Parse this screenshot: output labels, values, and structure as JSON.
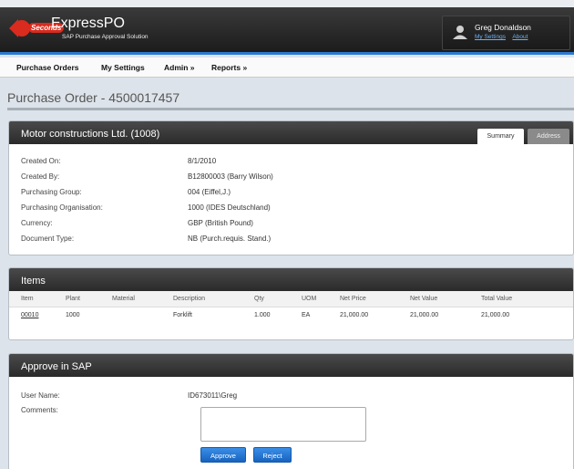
{
  "app": {
    "logo_word": "Seconds",
    "title": "ExpressPO",
    "subtitle": "SAP Purchase Approval Solution"
  },
  "user": {
    "name": "Greg Donaldson",
    "links": [
      "My Settings",
      "About"
    ]
  },
  "nav": [
    "Purchase Orders",
    "My Settings",
    "Admin »",
    "Reports »"
  ],
  "page_title": "Purchase Order - 4500017457",
  "header_panel": {
    "title": "Motor constructions Ltd. (1008)",
    "tabs": [
      "Summary",
      "Address"
    ],
    "active_tab": "Summary",
    "fields": [
      {
        "label": "Created On:",
        "value": "8/1/2010"
      },
      {
        "label": "Created By:",
        "value": "B12800003 (Barry Wilson)"
      },
      {
        "label": "Purchasing Group:",
        "value": "004 (Eiffel,J.)"
      },
      {
        "label": "Purchasing Organisation:",
        "value": "1000 (IDES Deutschland)"
      },
      {
        "label": "Currency:",
        "value": "GBP (British Pound)"
      },
      {
        "label": "Document Type:",
        "value": "NB (Purch.requis. Stand.)"
      }
    ]
  },
  "items_panel": {
    "title": "Items",
    "columns": [
      "Item",
      "Plant",
      "Material",
      "Description",
      "Qty",
      "UOM",
      "Net Price",
      "Net Value",
      "Total Value"
    ],
    "rows": [
      [
        "00010",
        "1000",
        "",
        "Forklift",
        "1.000",
        "EA",
        "21,000.00",
        "21,000.00",
        "21,000.00"
      ]
    ]
  },
  "approve_panel": {
    "title": "Approve in SAP",
    "user_name_label": "User Name:",
    "user_name_value": "ID673011\\Greg",
    "comments_label": "Comments:",
    "comments_value": "",
    "approve_label": "Approve",
    "reject_label": "Reject"
  },
  "colors": {
    "accent": "#2b7ad0",
    "button": "#1f6fcf",
    "header_dark": "#2a2a2a",
    "logo_red": "#d92b1e"
  }
}
